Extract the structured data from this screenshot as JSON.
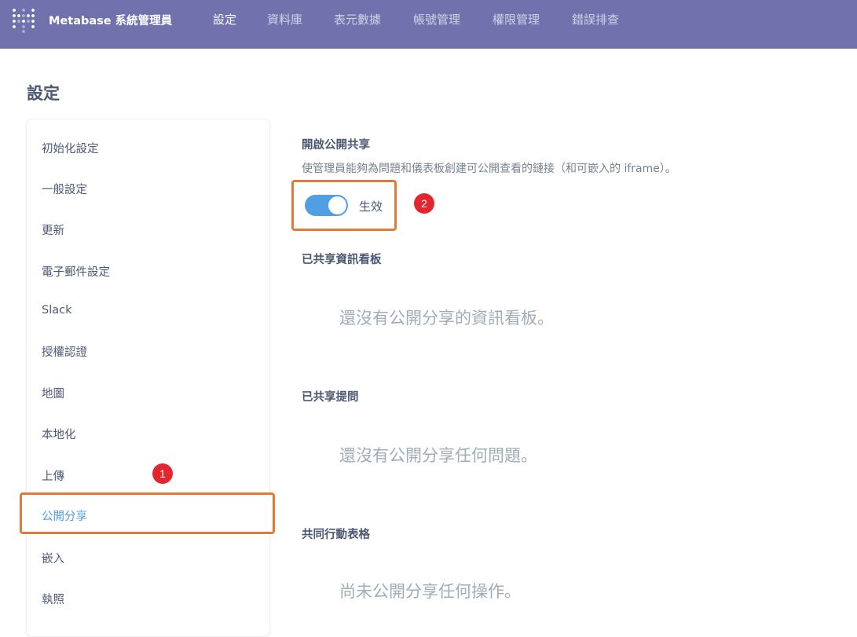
{
  "header": {
    "brand": "Metabase 系統管理員",
    "logo_icon": "metabase-logo-icon",
    "nav": [
      {
        "label": "設定",
        "active": true
      },
      {
        "label": "資料庫",
        "active": false
      },
      {
        "label": "表元數據",
        "active": false
      },
      {
        "label": "帳號管理",
        "active": false
      },
      {
        "label": "權限管理",
        "active": false
      },
      {
        "label": "錯誤排查",
        "active": false
      }
    ]
  },
  "page": {
    "title": "設定"
  },
  "sidebar": {
    "items": [
      {
        "label": "初始化設定",
        "active": false
      },
      {
        "label": "一般設定",
        "active": false
      },
      {
        "label": "更新",
        "active": false
      },
      {
        "label": "電子郵件設定",
        "active": false
      },
      {
        "label": "Slack",
        "active": false
      },
      {
        "label": "授權認證",
        "active": false
      },
      {
        "label": "地圖",
        "active": false
      },
      {
        "label": "本地化",
        "active": false
      },
      {
        "label": "上傳",
        "active": false
      },
      {
        "label": "公開分享",
        "active": true
      },
      {
        "label": "嵌入",
        "active": false
      },
      {
        "label": "執照",
        "active": false
      }
    ]
  },
  "annotations": {
    "badge1": "1",
    "badge2": "2",
    "badge_color": "#e3262e",
    "highlight_color": "#e07b39"
  },
  "public_sharing": {
    "title": "開啟公開共享",
    "description": "使管理員能夠為問題和儀表板創建可公開查看的鏈接（和可嵌入的 iframe）。",
    "toggle_label": "生效",
    "toggle_on": true
  },
  "shared_dashboards": {
    "title": "已共享資訊看板",
    "empty": "還沒有公開分享的資訊看板。"
  },
  "shared_questions": {
    "title": "已共享提問",
    "empty": "還沒有公開分享任何問題。"
  },
  "shared_actions": {
    "title": "共同行動表格",
    "empty": "尚未公開分享任何操作。"
  },
  "colors": {
    "header_bg": "#7172ad",
    "accent": "#509ee3"
  }
}
